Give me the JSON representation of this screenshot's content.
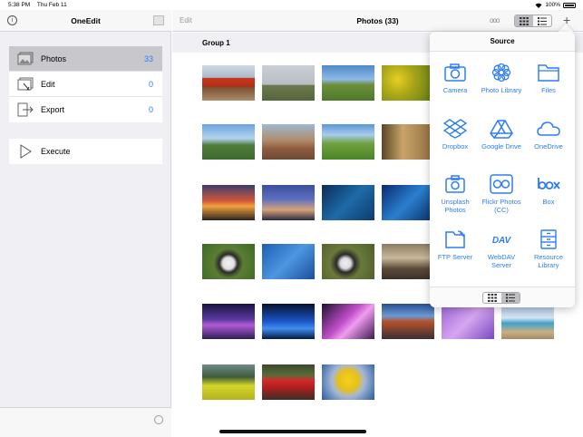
{
  "status": {
    "time": "5:38 PM",
    "date": "Thu Feb 11",
    "battery": "100%"
  },
  "sidebar": {
    "title": "OneEdit",
    "items": [
      {
        "label": "Photos",
        "count": "33",
        "icon": "photos-icon",
        "selected": true
      },
      {
        "label": "Edit",
        "count": "0",
        "icon": "edit-icon",
        "selected": false
      },
      {
        "label": "Export",
        "count": "0",
        "icon": "export-icon",
        "selected": false
      }
    ],
    "execute_label": "Execute"
  },
  "main": {
    "edit_label": "Edit",
    "title": "Photos (33)",
    "more_label": "ooo",
    "group_label": "Group 1"
  },
  "popover": {
    "title": "Source",
    "sources": [
      {
        "label": "Camera",
        "icon": "camera-icon"
      },
      {
        "label": "Photo Library",
        "icon": "photo-library-icon"
      },
      {
        "label": "Files",
        "icon": "files-icon"
      },
      {
        "label": "Dropbox",
        "icon": "dropbox-icon"
      },
      {
        "label": "Google Drive",
        "icon": "google-drive-icon"
      },
      {
        "label": "OneDrive",
        "icon": "onedrive-icon"
      },
      {
        "label": "Unsplash Photos",
        "icon": "unsplash-icon"
      },
      {
        "label": "Flickr Photos (CC)",
        "icon": "flickr-icon"
      },
      {
        "label": "Box",
        "icon": "box-icon"
      },
      {
        "label": "FTP Server",
        "icon": "ftp-server-icon"
      },
      {
        "label": "WebDAV Server",
        "icon": "webdav-server-icon"
      },
      {
        "label": "Resource Library",
        "icon": "resource-library-icon"
      }
    ]
  },
  "colors": {
    "accent": "#2d7cf6",
    "sidebar_bg": "#efeff4",
    "selected_row": "#c8c8cc"
  }
}
